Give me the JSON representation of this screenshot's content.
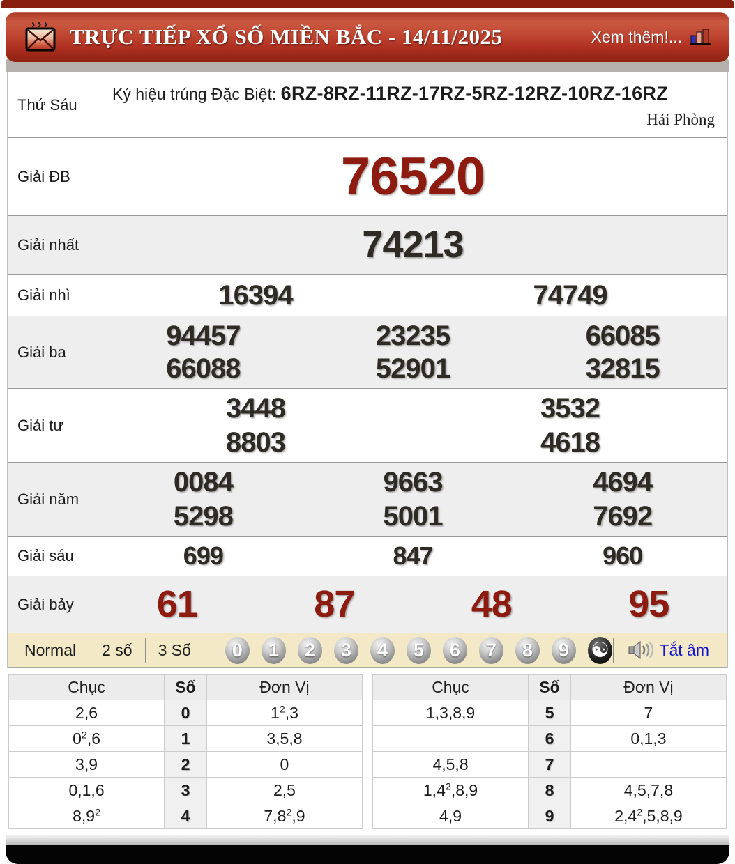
{
  "header": {
    "title": "TRỰC TIẾP XỔ SỐ MIỀN BẮC - 14/11/2025",
    "more_label": "Xem thêm!...",
    "envelope_icon": "envelope-with-steam",
    "chart_icon": "bar-chart",
    "accent_color": "#b03122"
  },
  "info_row": {
    "day": "Thứ Sáu",
    "symbol_label": "Ký hiệu trúng Đặc Biệt: ",
    "symbol_codes": "6RZ-8RZ-11RZ-17RZ-5RZ-12RZ-10RZ-16RZ",
    "province": "Hải Phòng"
  },
  "colors": {
    "special_red": "#8e1b10",
    "number_dark": "#2e2b25",
    "toolbar_bg": "#f3e9c6",
    "mute_blue": "#1616cf"
  },
  "prizes": [
    {
      "key": "db",
      "label": "Giải ĐB",
      "rows": [
        [
          "76520"
        ]
      ]
    },
    {
      "key": "nhat",
      "label": "Giải nhất",
      "rows": [
        [
          "74213"
        ]
      ]
    },
    {
      "key": "nhi",
      "label": "Giải nhì",
      "rows": [
        [
          "16394",
          "74749"
        ]
      ]
    },
    {
      "key": "ba",
      "label": "Giải ba",
      "rows": [
        [
          "94457",
          "23235",
          "66085"
        ],
        [
          "66088",
          "52901",
          "32815"
        ]
      ]
    },
    {
      "key": "tu",
      "label": "Giải tư",
      "rows": [
        [
          "3448",
          "3532"
        ],
        [
          "8803",
          "4618"
        ]
      ]
    },
    {
      "key": "nam",
      "label": "Giải năm",
      "rows": [
        [
          "0084",
          "9663",
          "4694"
        ],
        [
          "5298",
          "5001",
          "7692"
        ]
      ]
    },
    {
      "key": "sau",
      "label": "Giải sáu",
      "rows": [
        [
          "699",
          "847",
          "960"
        ]
      ]
    },
    {
      "key": "bay",
      "label": "Giải bảy",
      "rows": [
        [
          "61",
          "87",
          "48",
          "95"
        ]
      ]
    }
  ],
  "toolbar": {
    "modes": [
      "Normal",
      "2 số",
      "3 Số"
    ],
    "balls": [
      "0",
      "1",
      "2",
      "3",
      "4",
      "5",
      "6",
      "7",
      "8",
      "9"
    ],
    "yinyang_glyph": "☯",
    "yinyang_icon": "yin-yang",
    "speaker_icon": "speaker",
    "mute_label": "Tắt âm"
  },
  "stats": {
    "headers": [
      "Chục",
      "Số",
      "Đơn Vị"
    ],
    "left_rows": [
      [
        "2,6",
        "0",
        "1²,3"
      ],
      [
        "0²,6",
        "1",
        "3,5,8"
      ],
      [
        "3,9",
        "2",
        "0"
      ],
      [
        "0,1,6",
        "3",
        "2,5"
      ],
      [
        "8,9²",
        "4",
        "7,8²,9"
      ]
    ],
    "right_rows": [
      [
        "1,3,8,9",
        "5",
        "7"
      ],
      [
        "",
        "6",
        "0,1,3"
      ],
      [
        "4,5,8",
        "7",
        ""
      ],
      [
        "1,4²,8,9",
        "8",
        "4,5,7,8"
      ],
      [
        "4,9",
        "9",
        "2,4²,5,8,9"
      ]
    ]
  }
}
